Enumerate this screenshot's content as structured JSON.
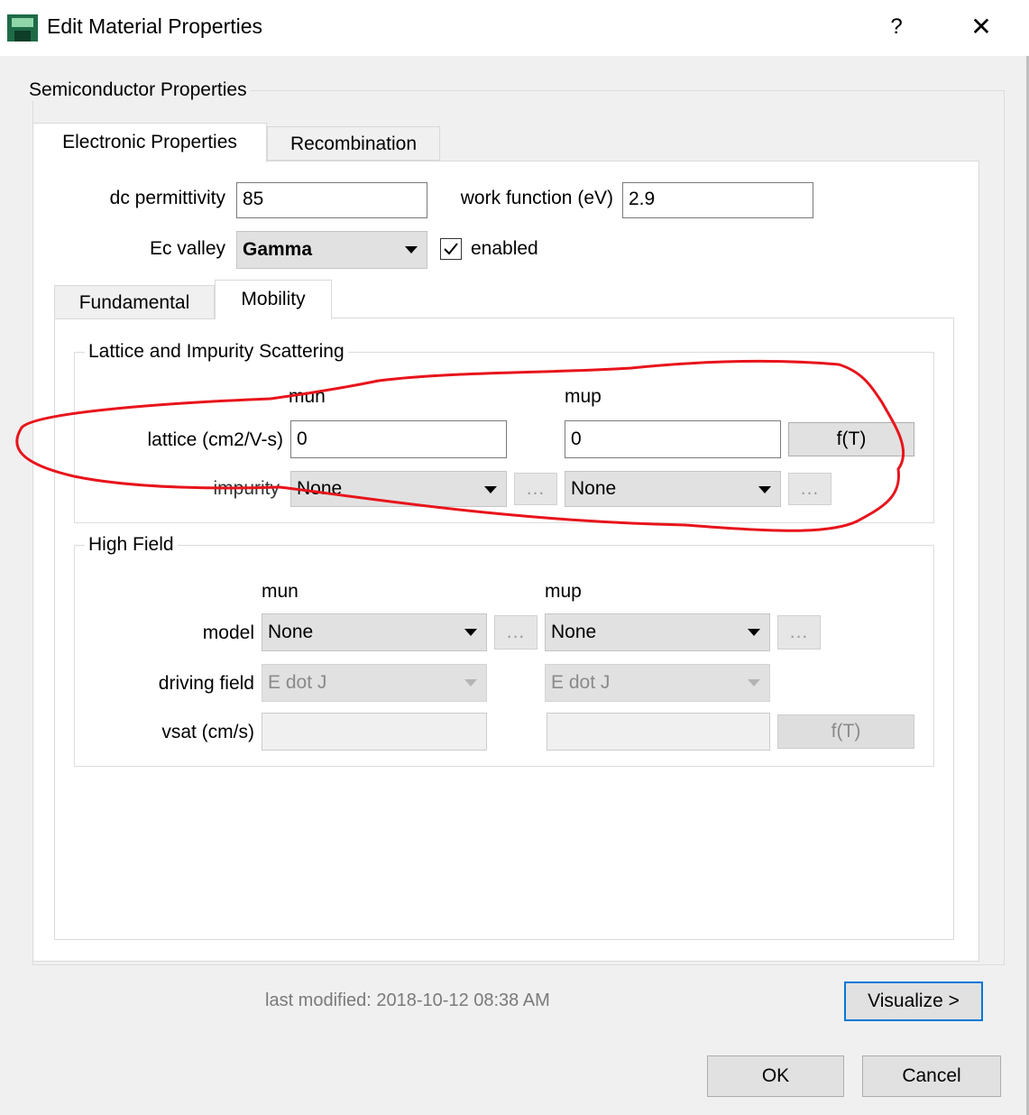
{
  "window": {
    "title": "Edit Material Properties",
    "help_label": "?",
    "close_label": "✕",
    "icon": "app-icon"
  },
  "semiconductor": {
    "group_title": "Semiconductor Properties",
    "tabs": [
      {
        "label": "Electronic Properties",
        "active": true
      },
      {
        "label": "Recombination",
        "active": false
      }
    ],
    "dc_permittivity": {
      "label": "dc permittivity",
      "value": "85"
    },
    "work_function": {
      "label": "work function (eV)",
      "value": "2.9"
    },
    "ec_valley": {
      "label": "Ec valley",
      "value": "Gamma"
    },
    "enabled": {
      "label": "enabled",
      "checked": true
    },
    "subtabs": [
      {
        "label": "Fundamental",
        "active": false
      },
      {
        "label": "Mobility",
        "active": true
      }
    ]
  },
  "lattice_group": {
    "title": "Lattice and Impurity Scattering",
    "mun_header": "mun",
    "mup_header": "mup",
    "lattice_label": "lattice (cm2/V-s)",
    "lattice_mun": "0",
    "lattice_mup": "0",
    "ft_label": "f(T)",
    "impurity_label": "impurity",
    "impurity_mun": "None",
    "impurity_mup": "None",
    "dots_label": "..."
  },
  "high_field": {
    "title": "High Field",
    "mun_header": "mun",
    "mup_header": "mup",
    "model_label": "model",
    "model_mun": "None",
    "model_mup": "None",
    "dots_label": "...",
    "driving_label": "driving field",
    "driving_mun": "E dot J",
    "driving_mup": "E dot J",
    "vsat_label": "vsat (cm/s)",
    "vsat_mun": "",
    "vsat_mup": "",
    "ft_label": "f(T)"
  },
  "footer": {
    "last_modified": "last modified: 2018-10-12 08:38 AM",
    "visualize_label": "Visualize >",
    "ok_label": "OK",
    "cancel_label": "Cancel"
  },
  "colors": {
    "annotation": "#e8141b",
    "focus": "#0078d7",
    "app_icon": "#1e6b48"
  }
}
